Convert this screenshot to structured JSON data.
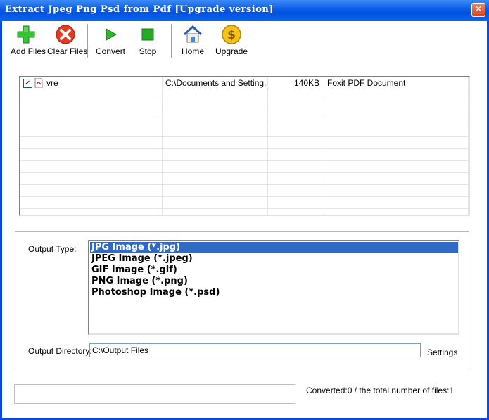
{
  "window": {
    "title": "Extract Jpeg Png Psd from Pdf [Upgrade version]",
    "close_glyph": "✕"
  },
  "toolbar": {
    "add_files": "Add Files",
    "clear_files": "Clear Files",
    "convert": "Convert",
    "stop": "Stop",
    "home": "Home",
    "upgrade": "Upgrade"
  },
  "file_list": {
    "rows": [
      {
        "checked": true,
        "name": "vre",
        "path": "C:\\Documents and Setting...",
        "size": "140KB",
        "type": "Foxit PDF Document"
      }
    ]
  },
  "output": {
    "type_label": "Output Type:",
    "types": [
      "JPG Image (*.jpg)",
      "JPEG Image (*.jpeg)",
      "GIF Image (*.gif)",
      "PNG Image (*.png)",
      "Photoshop Image (*.psd)"
    ],
    "selected_type": "JPG Image (*.jpg)",
    "dir_label": "Output Directory:",
    "dir_value": "C:\\Output Files",
    "settings_label": "Settings"
  },
  "status": {
    "progress": 0,
    "text": "Converted:0  /  the total number of files:1"
  },
  "colors": {
    "titlebar": "#0a5be8",
    "selection": "#316ac5",
    "add_icon": "#2db52d",
    "clear_icon": "#e23b22",
    "stop_icon": "#28a828"
  }
}
